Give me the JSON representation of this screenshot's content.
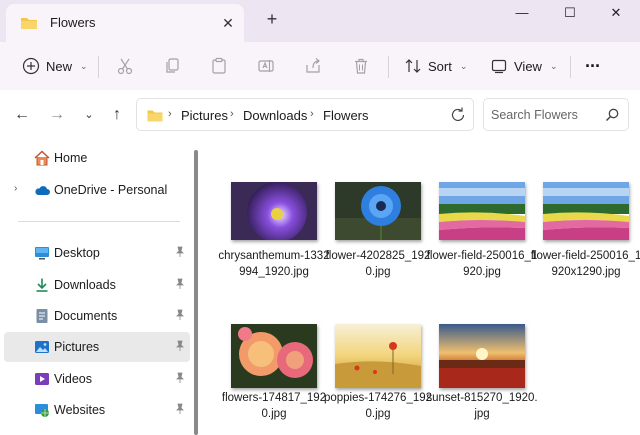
{
  "window": {
    "tab_title": "Flowers",
    "tab_close": "✕",
    "new_tab": "+",
    "minimize": "—",
    "maximize": "☐",
    "close": "✕"
  },
  "toolbar": {
    "new_label": "New",
    "sort_label": "Sort",
    "view_label": "View",
    "more_label": "···",
    "chevron": "⌄"
  },
  "breadcrumb": [
    "Pictures",
    "Downloads",
    "Flowers"
  ],
  "search": {
    "placeholder": "Search Flowers"
  },
  "sidebar": {
    "items": [
      {
        "label": "Home",
        "icon": "home-icon"
      },
      {
        "label": "OneDrive - Personal",
        "icon": "cloud-icon"
      },
      {
        "label": "Desktop",
        "icon": "desktop-icon"
      },
      {
        "label": "Downloads",
        "icon": "download-icon"
      },
      {
        "label": "Documents",
        "icon": "documents-icon"
      },
      {
        "label": "Pictures",
        "icon": "pictures-icon",
        "selected": true
      },
      {
        "label": "Videos",
        "icon": "videos-icon"
      },
      {
        "label": "Websites",
        "icon": "websites-icon"
      }
    ]
  },
  "files": [
    {
      "name": "chrysanthemum-1332994_1920.jpg"
    },
    {
      "name": "flower-4202825_1920.jpg"
    },
    {
      "name": "flower-field-250016_1920.jpg"
    },
    {
      "name": "flower-field-250016_1920x1290.jpg"
    },
    {
      "name": "flowers-174817_1920.jpg"
    },
    {
      "name": "poppies-174276_1920.jpg"
    },
    {
      "name": "sunset-815270_1920.jpg"
    }
  ],
  "colors": {
    "tabstrip_bg": "#eee5f3",
    "toolbar_bg": "#f8f4fa",
    "folder_yellow": "#f3c84a",
    "accent_blue": "#1e72c8",
    "selected_bg": "#e9e9ea"
  }
}
